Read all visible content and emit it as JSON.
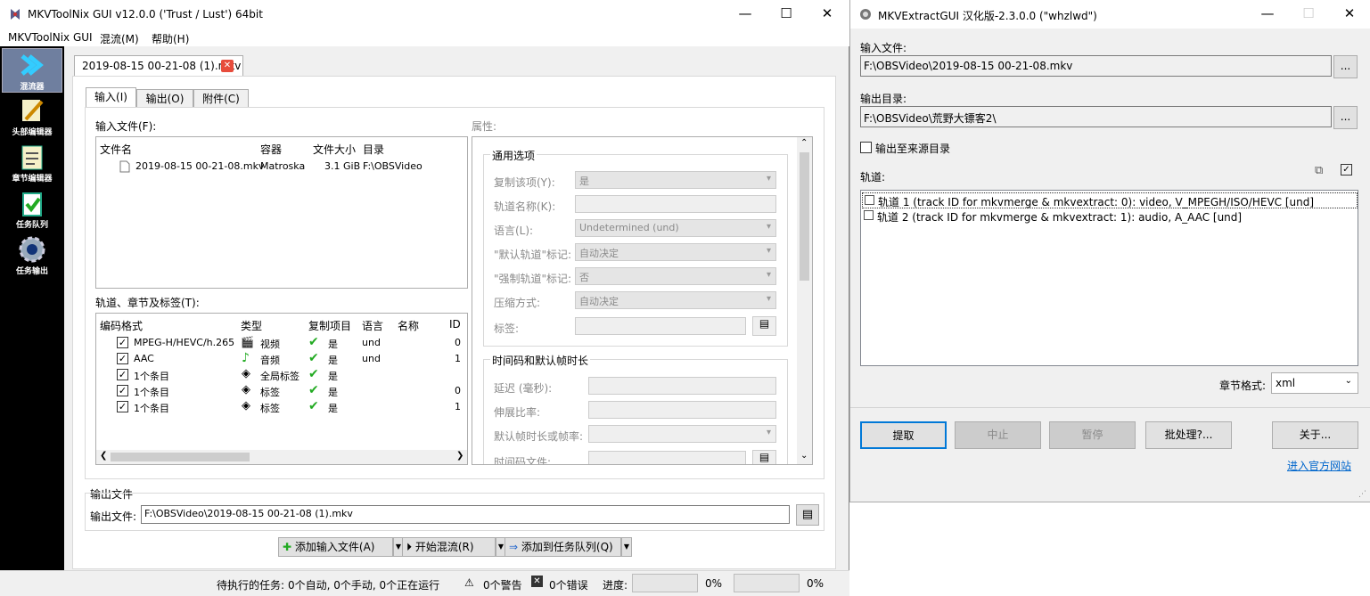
{
  "left_window": {
    "title": "MKVToolNix GUI v12.0.0 ('Trust / Lust') 64bit",
    "controls": {
      "minimize": "—",
      "maximize": "☐",
      "close": "✕"
    },
    "menu": [
      "MKVToolNix GUI",
      "混流(M)",
      "帮助(H)"
    ],
    "sidebar": [
      {
        "label": "混流器",
        "icon": "mux-icon"
      },
      {
        "label": "头部编辑器",
        "icon": "header-editor-icon"
      },
      {
        "label": "章节编辑器",
        "icon": "chapter-editor-icon"
      },
      {
        "label": "任务队列",
        "icon": "job-queue-icon"
      },
      {
        "label": "任务输出",
        "icon": "job-output-icon"
      }
    ],
    "doc_tab": "2019-08-15 00-21-08 (1).mkv",
    "tabs": [
      "输入(I)",
      "输出(O)",
      "附件(C)"
    ],
    "input_files_label": "输入文件(F):",
    "input_files_headers": [
      "文件名",
      "容器",
      "文件大小",
      "目录"
    ],
    "input_files": [
      {
        "name": "2019-08-15 00-21-08.mkv",
        "container": "Matroska",
        "size": "3.1 GiB",
        "dir": "F:\\OBSVideo"
      }
    ],
    "tracks_label": "轨道、章节及标签(T):",
    "tracks_headers": [
      "编码格式",
      "类型",
      "复制项目",
      "语言",
      "名称",
      "ID"
    ],
    "tracks": [
      {
        "codec": "MPEG-H/HEVC/h.265",
        "type": "视频",
        "copy": "是",
        "lang": "und",
        "id": "0"
      },
      {
        "codec": "AAC",
        "type": "音频",
        "copy": "是",
        "lang": "und",
        "id": "1"
      },
      {
        "codec": "1个条目",
        "type": "全局标签",
        "copy": "是",
        "lang": "",
        "id": ""
      },
      {
        "codec": "1个条目",
        "type": "标签",
        "copy": "是",
        "lang": "",
        "id": "0"
      },
      {
        "codec": "1个条目",
        "type": "标签",
        "copy": "是",
        "lang": "",
        "id": "1"
      }
    ],
    "properties_label": "属性:",
    "general_options": {
      "title": "通用选项",
      "copy_item": {
        "label": "复制该项(Y):",
        "value": "是"
      },
      "track_name": {
        "label": "轨道名称(K):",
        "value": ""
      },
      "language": {
        "label": "语言(L):",
        "value": "Undetermined (und)"
      },
      "default_flag": {
        "label": "\"默认轨道\"标记:",
        "value": "自动决定"
      },
      "forced_flag": {
        "label": "\"强制轨道\"标记:",
        "value": "否"
      },
      "compression": {
        "label": "压缩方式:",
        "value": "自动决定"
      },
      "tags": {
        "label": "标签:",
        "value": ""
      }
    },
    "timing": {
      "title": "时间码和默认帧时长",
      "delay": "延迟 (毫秒):",
      "stretch": "伸展比率:",
      "default_duration": "默认帧时长或帧率:",
      "timecode_file": "时间码文件:"
    },
    "output_group": "输出文件",
    "output_label": "输出文件:",
    "output_value": "F:\\OBSVideo\\2019-08-15 00-21-08 (1).mkv",
    "buttons": {
      "add": "添加输入文件(A)",
      "start": "开始混流(R)",
      "queue": "添加到任务队列(Q)"
    },
    "status": {
      "pending": "待执行的任务:",
      "counts": "0个自动, 0个手动, 0个正在运行",
      "warnings": "0个警告",
      "errors": "0个错误",
      "progress_label": "进度:",
      "progress1": "0%",
      "progress2": "0%"
    }
  },
  "right_window": {
    "title": "MKVExtractGUI 汉化版-2.3.0.0 (\"whzlwd\")",
    "controls": {
      "minimize": "—",
      "maximize": "☐",
      "close": "✕"
    },
    "input_label": "输入文件:",
    "input_value": "F:\\OBSVideo\\2019-08-15 00-21-08.mkv",
    "output_label": "输出目录:",
    "output_value": "F:\\OBSVideo\\荒野大镖客2\\",
    "browse": "...",
    "output_to_source": "输出至来源目录",
    "tracks_label": "轨道:",
    "tracks": [
      "轨道 1 (track ID for mkvmerge & mkvextract: 0): video, V_MPEGH/ISO/HEVC [und]",
      "轨道 2 (track ID for mkvmerge & mkvextract: 1): audio, A_AAC [und]"
    ],
    "chapter_format_label": "章节格式:",
    "chapter_format_value": "xml",
    "buttons": {
      "extract": "提取",
      "abort": "中止",
      "pause": "暂停",
      "batch": "批处理?...",
      "about": "关于..."
    },
    "website_link": "进入官方网站"
  }
}
